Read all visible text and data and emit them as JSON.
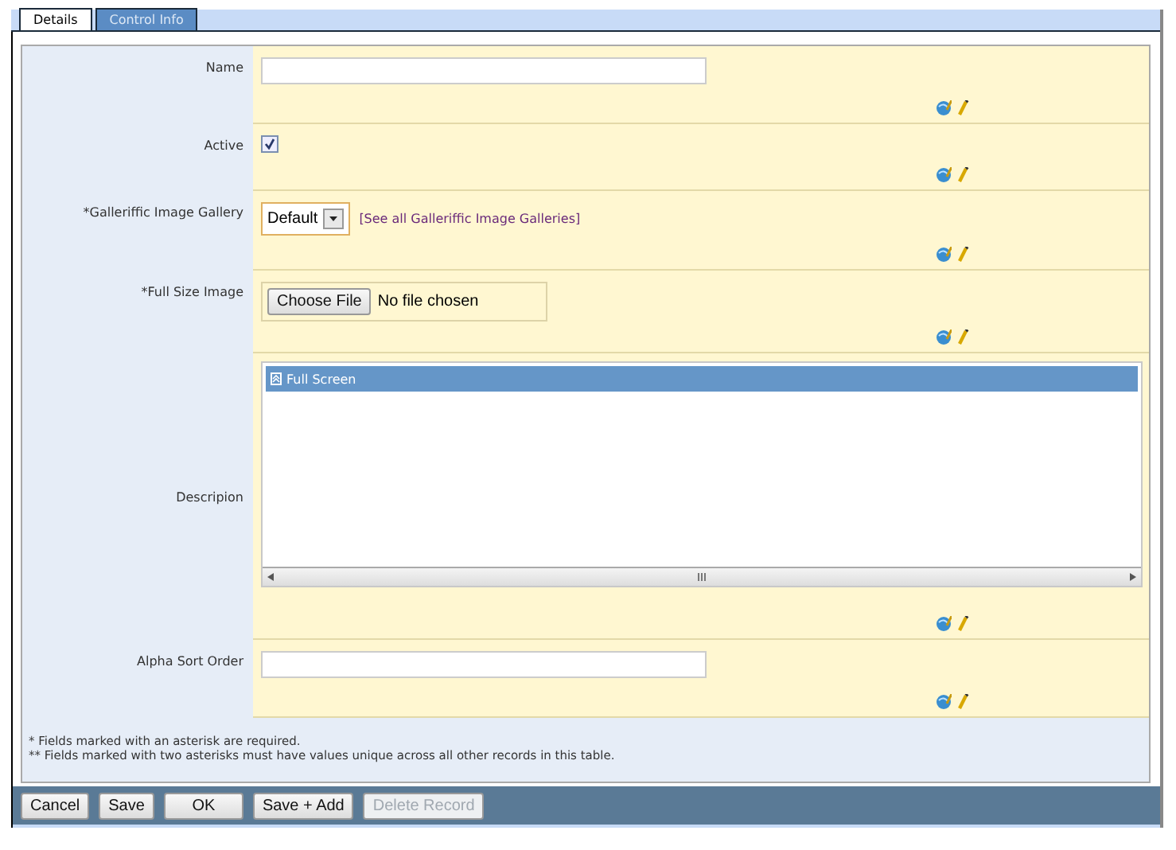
{
  "tabs": [
    {
      "label": "Details",
      "selected": true
    },
    {
      "label": "Control Info",
      "selected": false
    }
  ],
  "fields": [
    {
      "label": "Name",
      "kind": "text"
    },
    {
      "label": "Active",
      "kind": "checkbox",
      "checked": true
    },
    {
      "label": "*Galleriffic Image Gallery",
      "kind": "select",
      "value": "Default",
      "link": "[See all Galleriffic Image Galleries]"
    },
    {
      "label": "*Full Size Image",
      "kind": "file",
      "button": "Choose File",
      "status": "No file chosen"
    },
    {
      "label": "Descripion",
      "kind": "richtext",
      "toolbar": "Full Screen"
    },
    {
      "label": "Alpha Sort Order",
      "kind": "text"
    }
  ],
  "notes": [
    "* Fields marked with an asterisk are required.",
    "** Fields marked with two asterisks must have values unique across all other records in this table."
  ],
  "buttons": [
    {
      "label": "Cancel",
      "disabled": false
    },
    {
      "label": "Save",
      "disabled": false
    },
    {
      "label": "OK",
      "disabled": false
    },
    {
      "label": "Save + Add",
      "disabled": false
    },
    {
      "label": "Delete Record",
      "disabled": true
    }
  ]
}
